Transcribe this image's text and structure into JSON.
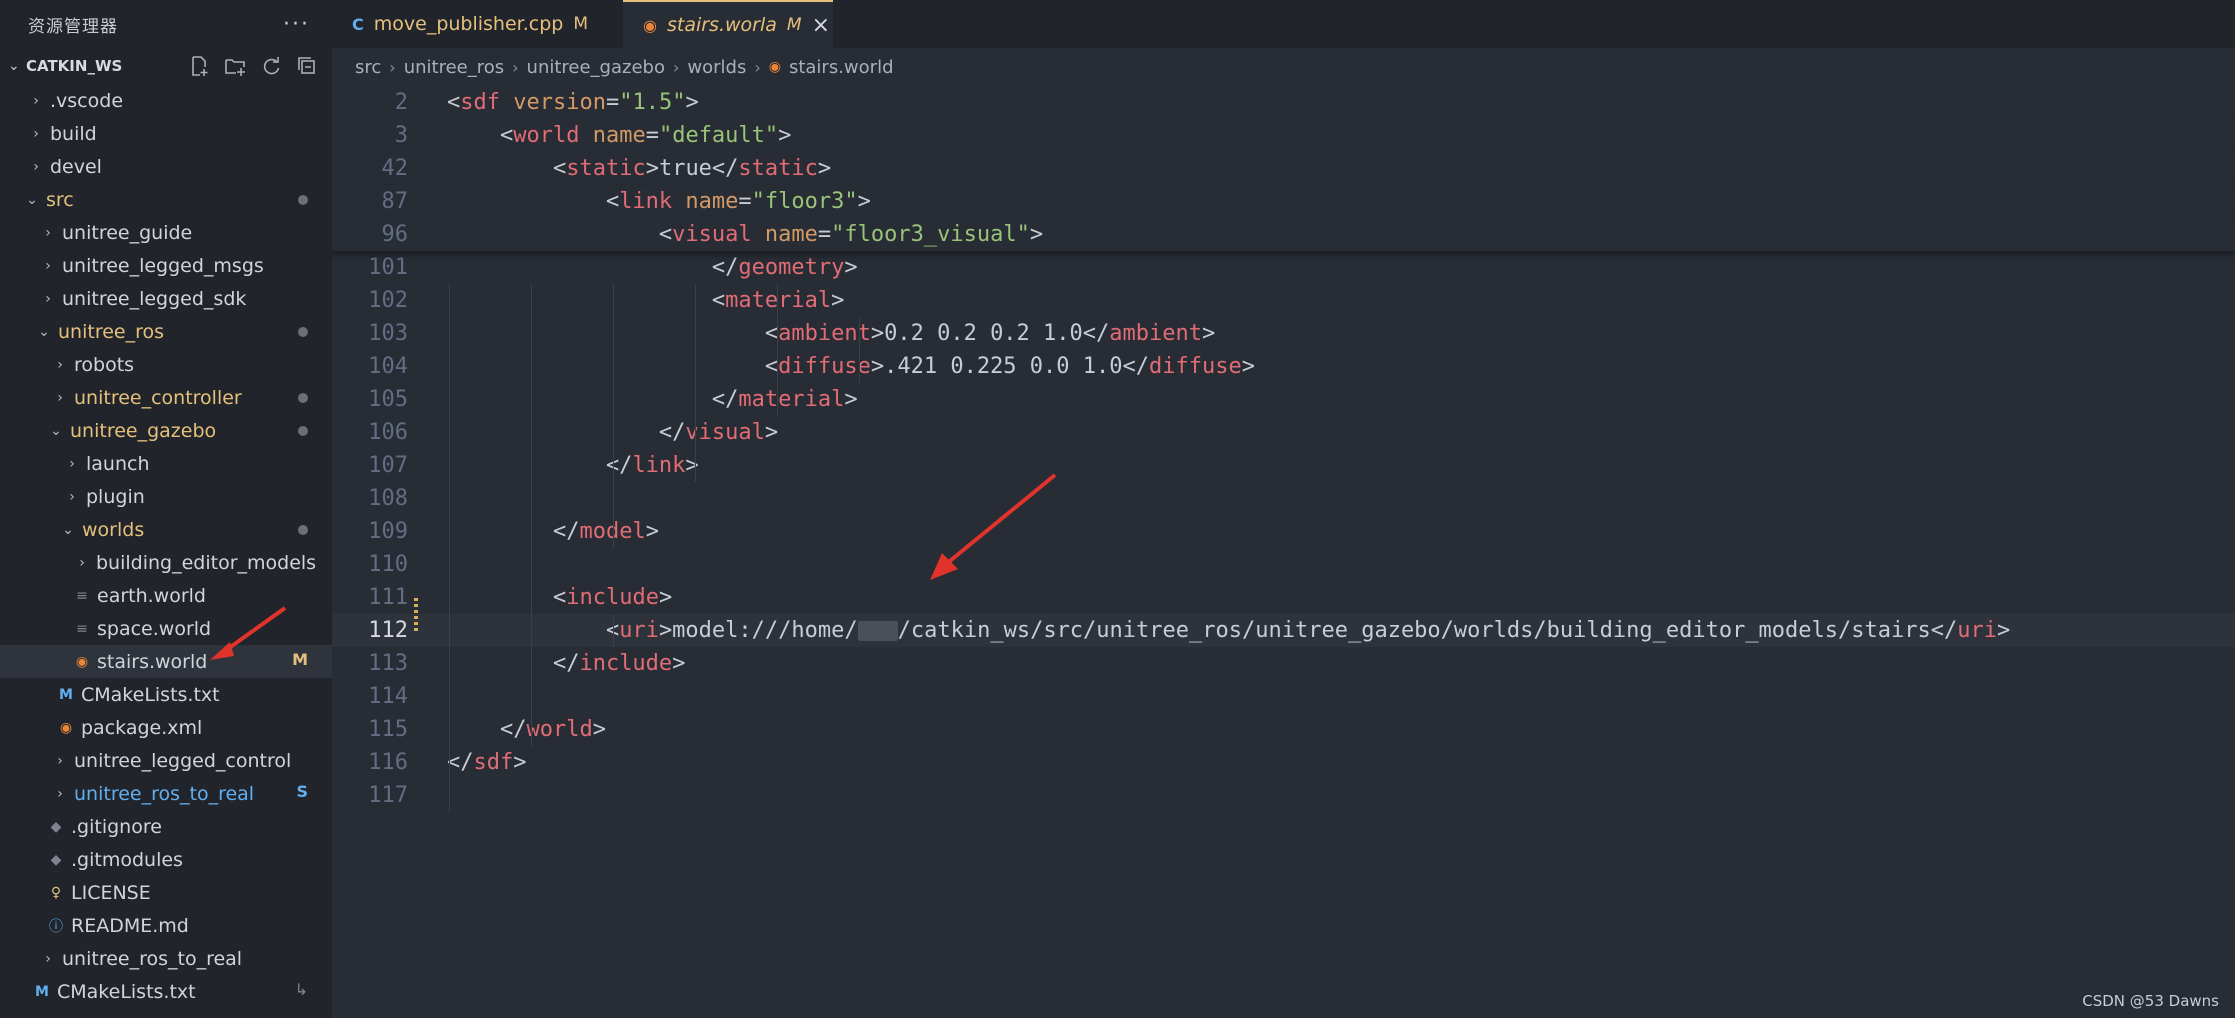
{
  "sidebar": {
    "title": "资源管理器",
    "workspace": "CATKIN_WS",
    "items": [
      {
        "label": ".vscode"
      },
      {
        "label": "build"
      },
      {
        "label": "devel"
      },
      {
        "label": "src"
      },
      {
        "label": "unitree_guide"
      },
      {
        "label": "unitree_legged_msgs"
      },
      {
        "label": "unitree_legged_sdk"
      },
      {
        "label": "unitree_ros"
      },
      {
        "label": "robots"
      },
      {
        "label": "unitree_controller"
      },
      {
        "label": "unitree_gazebo"
      },
      {
        "label": "launch"
      },
      {
        "label": "plugin"
      },
      {
        "label": "worlds"
      },
      {
        "label": "building_editor_models"
      },
      {
        "label": "earth.world"
      },
      {
        "label": "space.world"
      },
      {
        "label": "stairs.world",
        "badge": "M"
      },
      {
        "label": "CMakeLists.txt"
      },
      {
        "label": "package.xml"
      },
      {
        "label": "unitree_legged_control"
      },
      {
        "label": "unitree_ros_to_real",
        "badge": "S"
      },
      {
        "label": ".gitignore"
      },
      {
        "label": ".gitmodules"
      },
      {
        "label": "LICENSE"
      },
      {
        "label": "README.md"
      },
      {
        "label": "unitree_ros_to_real"
      },
      {
        "label": "CMakeLists.txt"
      }
    ]
  },
  "tabs": [
    {
      "label": "move_publisher.cpp",
      "flag": "M",
      "icon": "C"
    },
    {
      "label": "stairs.worla",
      "flag": "M",
      "icon": "rss-icon"
    }
  ],
  "breadcrumb": [
    "src",
    "unitree_ros",
    "unitree_gazebo",
    "worlds",
    "stairs.world"
  ],
  "editor": {
    "lines": [
      {
        "n": "2",
        "parts": [
          [
            "pun",
            "<"
          ],
          [
            "tag",
            "sdf"
          ],
          [
            "pun",
            " "
          ],
          [
            "attr",
            "version"
          ],
          [
            "pun",
            "="
          ],
          [
            "str",
            "\"1.5\""
          ],
          [
            "pun",
            ">"
          ]
        ]
      },
      {
        "n": "3",
        "parts": [
          [
            "pun",
            "    <"
          ],
          [
            "tag",
            "world"
          ],
          [
            "pun",
            " "
          ],
          [
            "attr",
            "name"
          ],
          [
            "pun",
            "="
          ],
          [
            "str",
            "\"default\""
          ],
          [
            "pun",
            ">"
          ]
        ]
      },
      {
        "n": "42",
        "parts": [
          [
            "pun",
            "        <"
          ],
          [
            "tag",
            "static"
          ],
          [
            "pun",
            ">true</"
          ],
          [
            "tag",
            "static"
          ],
          [
            "pun",
            ">"
          ]
        ]
      },
      {
        "n": "87",
        "parts": [
          [
            "pun",
            "            <"
          ],
          [
            "tag",
            "link"
          ],
          [
            "pun",
            " "
          ],
          [
            "attr",
            "name"
          ],
          [
            "pun",
            "="
          ],
          [
            "str",
            "\"floor3\""
          ],
          [
            "pun",
            ">"
          ]
        ]
      },
      {
        "n": "96",
        "parts": [
          [
            "pun",
            "                <"
          ],
          [
            "tag",
            "visual"
          ],
          [
            "pun",
            " "
          ],
          [
            "attr",
            "name"
          ],
          [
            "pun",
            "="
          ],
          [
            "str",
            "\"floor3_visual\""
          ],
          [
            "pun",
            ">"
          ]
        ]
      },
      {
        "n": "102",
        "parts": [
          [
            "pun",
            "                    <"
          ],
          [
            "tag",
            "material"
          ],
          [
            "pun",
            ">"
          ]
        ]
      },
      {
        "n": "103",
        "parts": [
          [
            "pun",
            "                        <"
          ],
          [
            "tag",
            "ambient"
          ],
          [
            "pun",
            ">0.2 0.2 0.2 1.0</"
          ],
          [
            "tag",
            "ambient"
          ],
          [
            "pun",
            ">"
          ]
        ]
      },
      {
        "n": "104",
        "parts": [
          [
            "pun",
            "                        <"
          ],
          [
            "tag",
            "diffuse"
          ],
          [
            "pun",
            ">.421 0.225 0.0 1.0</"
          ],
          [
            "tag",
            "diffuse"
          ],
          [
            "pun",
            ">"
          ]
        ]
      },
      {
        "n": "105",
        "parts": [
          [
            "pun",
            "                    </"
          ],
          [
            "tag",
            "material"
          ],
          [
            "pun",
            ">"
          ]
        ]
      },
      {
        "n": "106",
        "parts": [
          [
            "pun",
            "                </"
          ],
          [
            "tag",
            "visual"
          ],
          [
            "pun",
            ">"
          ]
        ]
      },
      {
        "n": "107",
        "parts": [
          [
            "pun",
            "            </"
          ],
          [
            "tag",
            "link"
          ],
          [
            "pun",
            ">"
          ]
        ]
      },
      {
        "n": "108",
        "parts": []
      },
      {
        "n": "109",
        "parts": [
          [
            "pun",
            "        </"
          ],
          [
            "tag",
            "model"
          ],
          [
            "pun",
            ">"
          ]
        ]
      },
      {
        "n": "110",
        "parts": []
      },
      {
        "n": "111",
        "parts": [
          [
            "pun",
            "        <"
          ],
          [
            "tag",
            "include"
          ],
          [
            "pun",
            ">"
          ]
        ]
      },
      {
        "n": "112",
        "parts": [
          [
            "pun",
            "            <"
          ],
          [
            "tag",
            "uri"
          ],
          [
            "pun",
            ">model:///home/"
          ],
          [
            "blur",
            ""
          ],
          [
            "pun",
            "/catkin_ws/src/unitree_ros/unitree_gazebo/worlds/building_editor_models/stairs</"
          ],
          [
            "tag",
            "uri"
          ],
          [
            "pun",
            ">"
          ]
        ]
      },
      {
        "n": "113",
        "parts": [
          [
            "pun",
            "        </"
          ],
          [
            "tag",
            "include"
          ],
          [
            "pun",
            ">"
          ]
        ]
      },
      {
        "n": "114",
        "parts": []
      },
      {
        "n": "115",
        "parts": [
          [
            "pun",
            "    </"
          ],
          [
            "tag",
            "world"
          ],
          [
            "pun",
            ">"
          ]
        ]
      },
      {
        "n": "116",
        "parts": [
          [
            "pun",
            "</"
          ],
          [
            "tag",
            "sdf"
          ],
          [
            "pun",
            ">"
          ]
        ]
      },
      {
        "n": "117",
        "parts": []
      }
    ],
    "partial_line": {
      "n": "101",
      "text": "</geometry>"
    }
  },
  "watermark": "CSDN @53    Dawns",
  "colors": {
    "modified": "#e5c07b",
    "untracked": "#61afef",
    "tag": "#e06c75",
    "attr": "#d19a66",
    "string": "#98c379",
    "arrow": "#e0332b"
  }
}
